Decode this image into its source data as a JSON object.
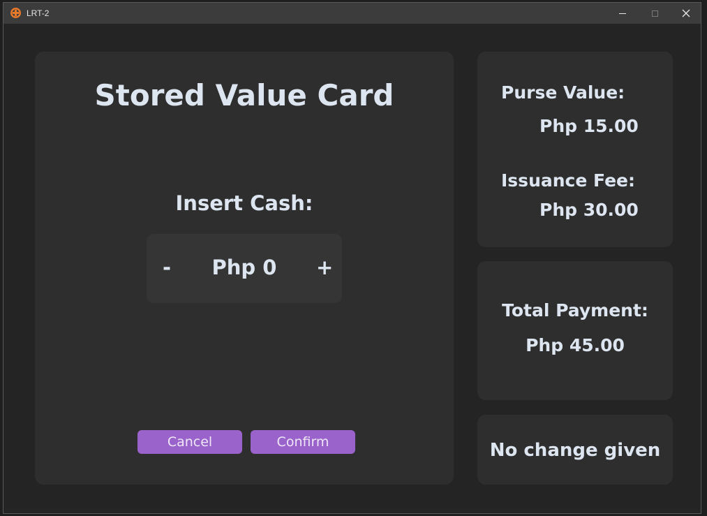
{
  "window": {
    "title": "LRT-2",
    "controls": {
      "minimize": "—",
      "maximize": "☐",
      "close": "✕"
    }
  },
  "main": {
    "title": "Stored Value Card",
    "insert_label": "Insert Cash:",
    "stepper": {
      "minus": "-",
      "value": "Php 0",
      "plus": "+"
    },
    "cancel_label": "Cancel",
    "confirm_label": "Confirm"
  },
  "fees": {
    "purse_label": "Purse Value:",
    "purse_value": "Php 15.00",
    "issuance_label": "Issuance Fee:",
    "issuance_value": "Php 30.00"
  },
  "total": {
    "label": "Total Payment:",
    "value": "Php 45.00"
  },
  "change": {
    "message": "No change given"
  },
  "colors": {
    "accent": "#9a63cb",
    "text": "#dde6f0",
    "panel": "#2e2e2e",
    "background": "#242424",
    "app_icon": "#e8782a"
  },
  "icons": {
    "app": "lrt-logo-icon"
  }
}
